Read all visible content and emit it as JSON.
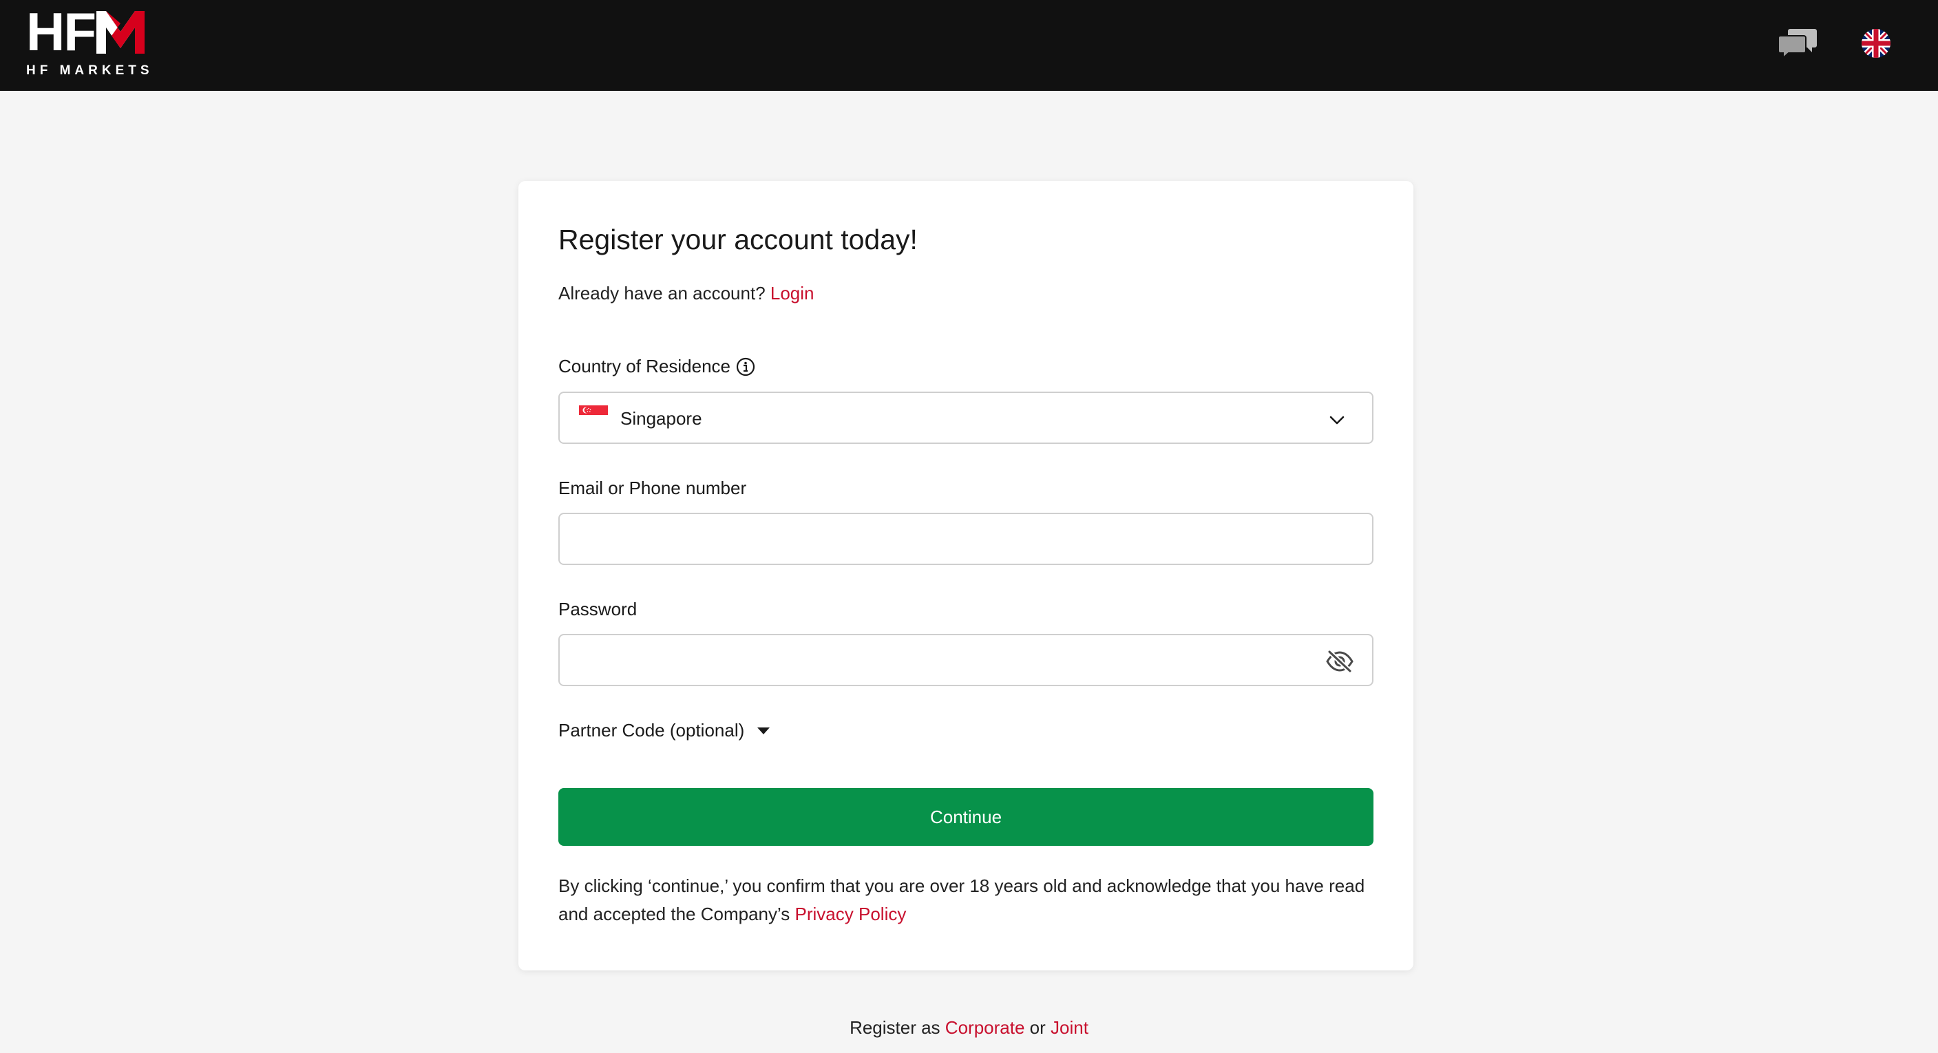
{
  "header": {
    "logo_letters": "HF",
    "logo_subtitle": "HF MARKETS",
    "chat_icon": "chat-bubbles-icon",
    "language_icon": "uk-flag-icon"
  },
  "form": {
    "title": "Register your account today!",
    "already_text": "Already have an account? ",
    "login_link": "Login",
    "country_label": "Country of Residence",
    "country_value": "Singapore",
    "email_label": "Email or Phone number",
    "email_value": "",
    "password_label": "Password",
    "password_value": "",
    "partner_label": "Partner Code (optional)",
    "continue_label": "Continue",
    "disclaimer_text": "By clicking ‘continue,’ you confirm that you are over 18 years old and acknowledge that you have read and accepted the Company’s ",
    "privacy_link": "Privacy Policy"
  },
  "footer": {
    "register_as": "Register as ",
    "corporate_link": "Corporate",
    "or_text": " or ",
    "joint_link": "Joint"
  },
  "colors": {
    "accent_red": "#c8102e",
    "button_green": "#07924a",
    "topbar": "#111111"
  }
}
